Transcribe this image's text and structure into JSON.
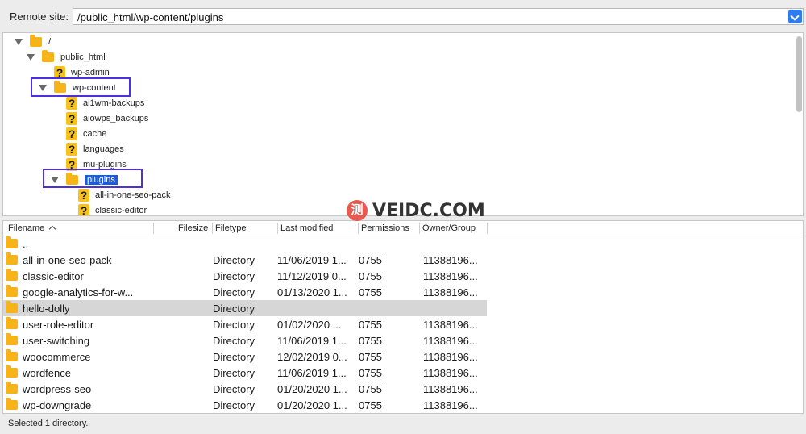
{
  "remote_site": {
    "label": "Remote site:",
    "path": "/public_html/wp-content/plugins"
  },
  "tree": [
    {
      "label": "/",
      "icon": "folder-icon",
      "expanded": true,
      "indent": 0
    },
    {
      "label": "public_html",
      "icon": "folder-icon",
      "expanded": true,
      "indent": 1
    },
    {
      "label": "wp-admin",
      "icon": "question-icon",
      "expanded": false,
      "indent": 2
    },
    {
      "label": "wp-content",
      "icon": "folder-icon",
      "expanded": true,
      "indent": 2
    },
    {
      "label": "ai1wm-backups",
      "icon": "question-icon",
      "expanded": false,
      "indent": 3
    },
    {
      "label": "aiowps_backups",
      "icon": "question-icon",
      "expanded": false,
      "indent": 3
    },
    {
      "label": "cache",
      "icon": "question-icon",
      "expanded": false,
      "indent": 3
    },
    {
      "label": "languages",
      "icon": "question-icon",
      "expanded": false,
      "indent": 3
    },
    {
      "label": "mu-plugins",
      "icon": "question-icon",
      "expanded": false,
      "indent": 3
    },
    {
      "label": "plugins",
      "icon": "folder-icon",
      "expanded": true,
      "indent": 3,
      "selected": true
    },
    {
      "label": "all-in-one-seo-pack",
      "icon": "question-icon",
      "expanded": false,
      "indent": 4
    },
    {
      "label": "classic-editor",
      "icon": "question-icon",
      "expanded": false,
      "indent": 4
    }
  ],
  "columns": {
    "filename": "Filename",
    "filesize": "Filesize",
    "filetype": "Filetype",
    "last_modified": "Last modified",
    "permissions": "Permissions",
    "owner_group": "Owner/Group"
  },
  "files": [
    {
      "name": "..",
      "type": "",
      "modified": "",
      "perm": "",
      "owner": ""
    },
    {
      "name": "all-in-one-seo-pack",
      "type": "Directory",
      "modified": "11/06/2019 1...",
      "perm": "0755",
      "owner": "11388196..."
    },
    {
      "name": "classic-editor",
      "type": "Directory",
      "modified": "11/12/2019 0...",
      "perm": "0755",
      "owner": "11388196..."
    },
    {
      "name": "google-analytics-for-w...",
      "type": "Directory",
      "modified": "01/13/2020 1...",
      "perm": "0755",
      "owner": "11388196..."
    },
    {
      "name": "hello-dolly",
      "type": "Directory",
      "modified": "",
      "perm": "",
      "owner": "",
      "selected": true
    },
    {
      "name": "user-role-editor",
      "type": "Directory",
      "modified": "01/02/2020 ...",
      "perm": "0755",
      "owner": "11388196..."
    },
    {
      "name": "user-switching",
      "type": "Directory",
      "modified": "11/06/2019 1...",
      "perm": "0755",
      "owner": "11388196..."
    },
    {
      "name": "woocommerce",
      "type": "Directory",
      "modified": "12/02/2019 0...",
      "perm": "0755",
      "owner": "11388196..."
    },
    {
      "name": "wordfence",
      "type": "Directory",
      "modified": "11/06/2019 1...",
      "perm": "0755",
      "owner": "11388196..."
    },
    {
      "name": "wordpress-seo",
      "type": "Directory",
      "modified": "01/20/2020 1...",
      "perm": "0755",
      "owner": "11388196..."
    },
    {
      "name": "wp-downgrade",
      "type": "Directory",
      "modified": "01/20/2020 1...",
      "perm": "0755",
      "owner": "11388196..."
    }
  ],
  "watermark": {
    "seal": "测",
    "text": "VEIDC.COM"
  },
  "status": "Selected 1 directory.",
  "colors": {
    "folder": "#f7b318",
    "selection": "#1a5be6",
    "highlight_box": "#4b2fe0",
    "selected_row": "#d6d6d6"
  }
}
